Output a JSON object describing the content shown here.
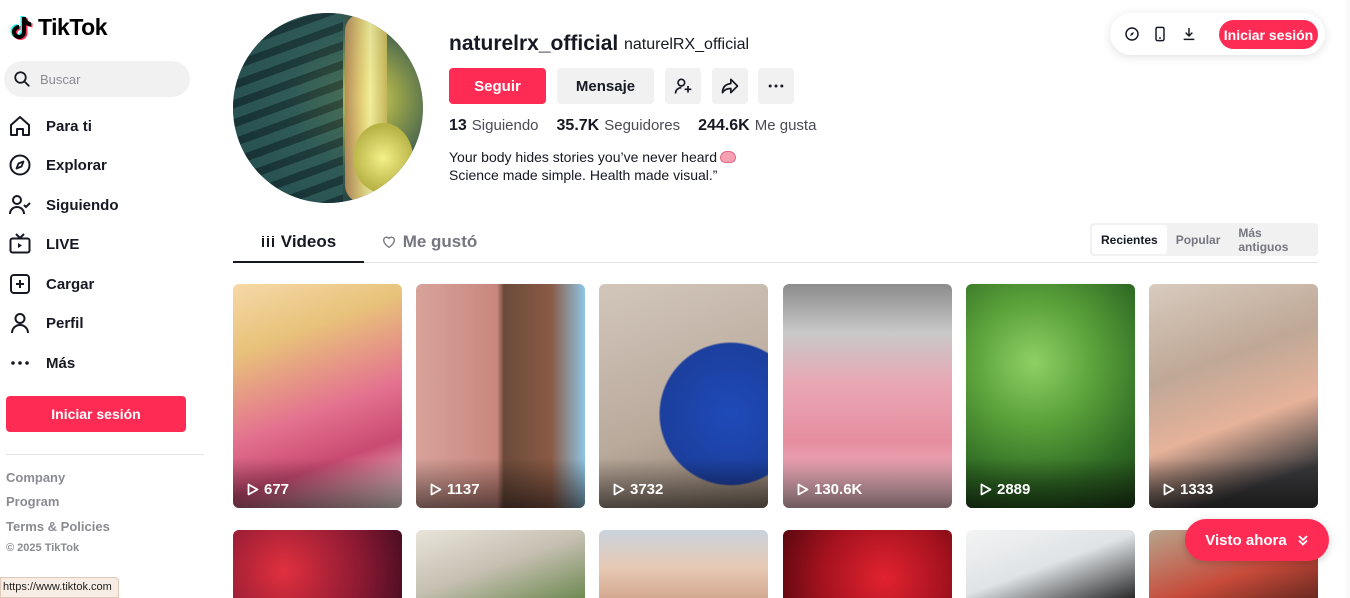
{
  "app": {
    "name": "TikTok"
  },
  "search": {
    "placeholder": "Buscar"
  },
  "nav": {
    "for_you": "Para ti",
    "explore": "Explorar",
    "following": "Siguiendo",
    "live": "LIVE",
    "upload": "Cargar",
    "profile": "Perfil",
    "more": "Más"
  },
  "sidebar_login": "Iniciar sesión",
  "footer": {
    "company": "Company",
    "program": "Program",
    "terms": "Terms & Policies",
    "copyright": "© 2025 TikTok"
  },
  "status_url": "https://www.tiktok.com",
  "profile": {
    "username": "naturelrx_official",
    "nickname": "naturelRX_official",
    "follow_label": "Seguir",
    "message_label": "Mensaje",
    "stats": {
      "following_count": "13",
      "following_label": "Siguiendo",
      "followers_count": "35.7K",
      "followers_label": "Seguidores",
      "likes_count": "244.6K",
      "likes_label": "Me gusta"
    },
    "bio_line1": "Your body hides stories you’ve never heard",
    "bio_line2": "Science made simple. Health made visual.”"
  },
  "topbar": {
    "login_label": "Iniciar sesión"
  },
  "tabs": {
    "videos": "Videos",
    "liked": "Me gustó"
  },
  "sort": {
    "recent": "Recientes",
    "popular": "Popular",
    "oldest": "Más antiguos"
  },
  "videos": [
    {
      "views": "677"
    },
    {
      "views": "1137"
    },
    {
      "views": "3732"
    },
    {
      "views": "130.6K"
    },
    {
      "views": "2889"
    },
    {
      "views": "1333"
    }
  ],
  "watched_now": "Visto ahora",
  "colors": {
    "accent": "#fe2c55",
    "text": "#161823",
    "muted": "#8a8b91"
  }
}
